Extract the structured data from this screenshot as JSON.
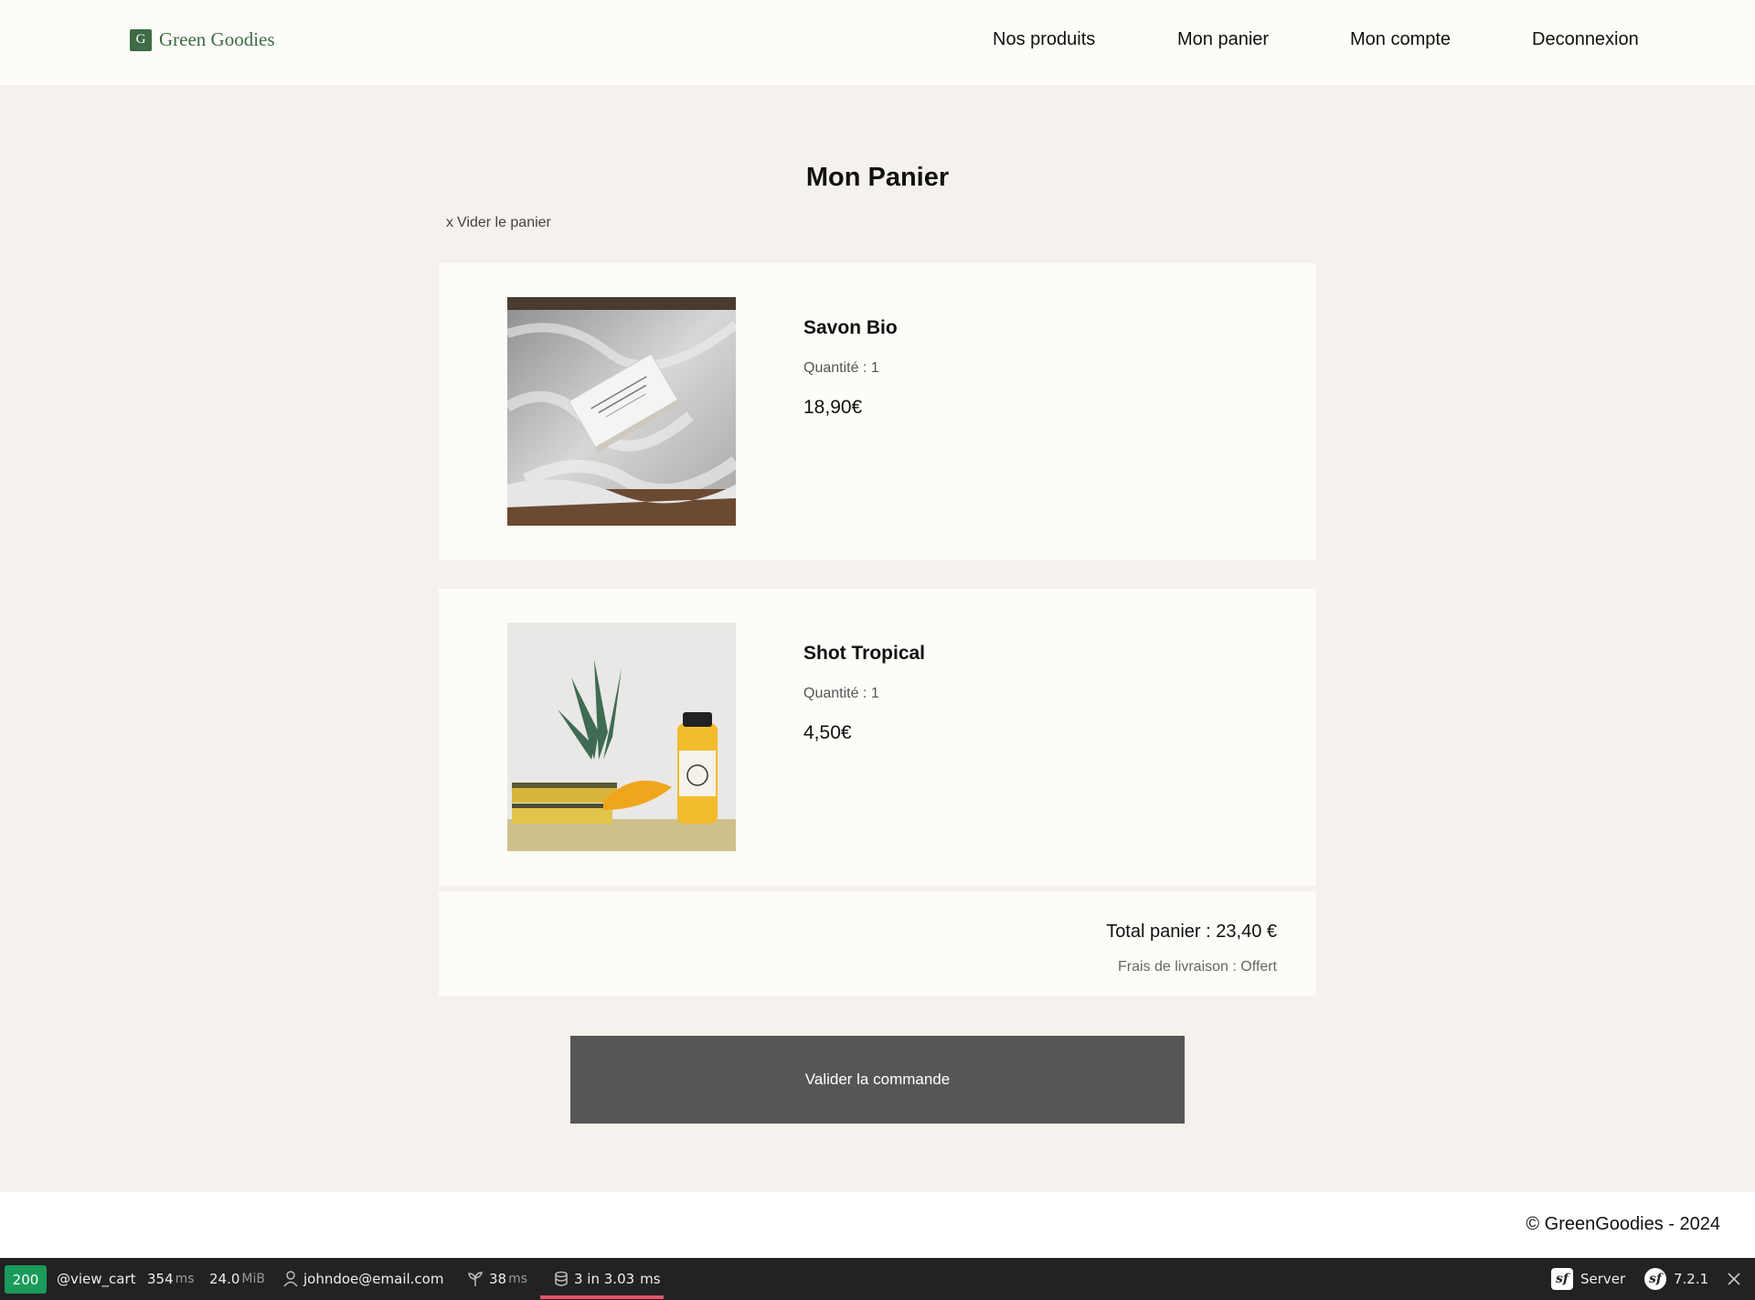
{
  "header": {
    "logo_letter": "G",
    "brand": "Green Goodies",
    "nav": [
      {
        "label": "Nos produits"
      },
      {
        "label": "Mon panier"
      },
      {
        "label": "Mon compte"
      },
      {
        "label": "Deconnexion"
      }
    ]
  },
  "cart": {
    "title": "Mon Panier",
    "clear_icon": "x",
    "clear_label": "Vider le panier",
    "items": [
      {
        "name": "Savon Bio",
        "quantity_label": "Quantité",
        "quantity": "1",
        "price": "18,90€",
        "image": "soap-bar-photo"
      },
      {
        "name": "Shot Tropical",
        "quantity_label": "Quantité",
        "quantity": "1",
        "price": "4,50€",
        "image": "pineapple-juice-photo"
      }
    ],
    "total_label": "Total panier",
    "total_value": "23,40 €",
    "shipping_label": "Frais de livraison",
    "shipping_value": "Offert",
    "validate_label": "Valider la commande"
  },
  "footer": {
    "copyright": "© GreenGoodies - 2024"
  },
  "debug_toolbar": {
    "status": "200",
    "route": "@view_cart",
    "time_value": "354",
    "time_unit": "ms",
    "memory_value": "24.0",
    "memory_unit": "MiB",
    "user": "johndoe@email.com",
    "init_value": "38",
    "init_unit": "ms",
    "db_queries": "3 in 3.03",
    "db_unit": "ms",
    "server_label": "Server",
    "version": "7.2.1",
    "colors": {
      "status_ok": "#1a9a5b",
      "db_accent": "#e5556b"
    }
  }
}
